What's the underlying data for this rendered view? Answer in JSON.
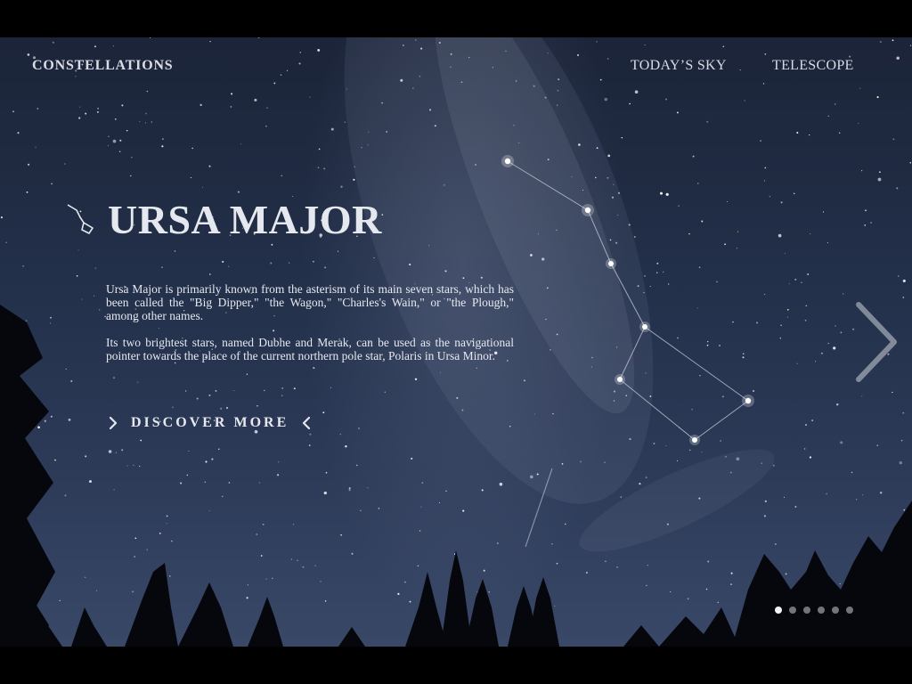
{
  "nav": {
    "brand": "CONSTELLATIONS",
    "links": [
      "TODAY’S SKY",
      "TELESCOPE"
    ]
  },
  "hero": {
    "icon": "big-dipper-icon",
    "title": "URSA MAJOR",
    "paragraphs": [
      "Ursa Major is primarily known from the asterism of its main seven stars, which has been called the \"Big Dipper,\" \"the Wagon,\" \"Charles's Wain,\" or \"the Plough,\" among other names.",
      "Its two brightest stars, named Dubhe and Merak, can be used as the navigational pointer towards the place of the current northern pole star, Polaris in Ursa Minor."
    ],
    "cta": {
      "label": "DISCOVER MORE",
      "left_icon": "chevron-right-icon",
      "right_icon": "chevron-left-icon"
    }
  },
  "carousel": {
    "next_icon": "chevron-right-icon",
    "total_slides": 6,
    "active_slide": 1
  },
  "colors": {
    "text": "#e6e8ef",
    "letterbox": "#000000",
    "sky_top": "#1b2438",
    "sky_bottom": "#3a4868",
    "constellation_line": "#c8ccd6"
  }
}
